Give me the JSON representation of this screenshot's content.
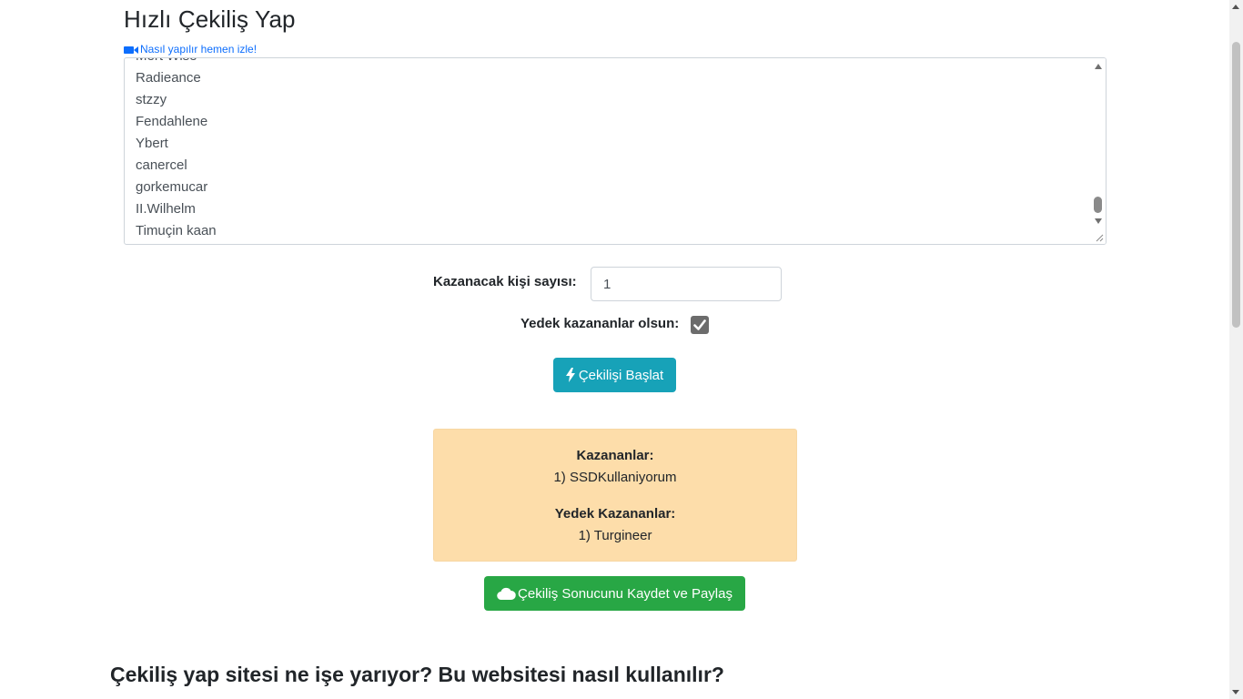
{
  "header": {
    "title": "Hızlı Çekiliş Yap",
    "howto_link": "Nasıl yapılır hemen izle!"
  },
  "participants": {
    "names": [
      "Mert Wise",
      "Radieance",
      "stzzy",
      "Fendahlene",
      "Ybert",
      "canercel",
      "gorkemucar",
      "II.Wilhelm",
      "Timuçin kaan"
    ]
  },
  "form": {
    "winner_count_label": "Kazanacak kişi sayısı:",
    "winner_count_value": "1",
    "backup_label": "Yedek kazananlar olsun:",
    "backup_checked": true,
    "start_button": "Çekilişi Başlat"
  },
  "results": {
    "winners_heading": "Kazananlar:",
    "winners": [
      "1) SSDKullaniyorum"
    ],
    "backup_heading": "Yedek Kazananlar:",
    "backups": [
      "1) Turgineer"
    ]
  },
  "save_button": "Çekiliş Sonucunu Kaydet ve Paylaş",
  "section": {
    "title": "Çekiliş yap sitesi ne işe yarıyor? Bu websitesi nasıl kullanılır?"
  },
  "colors": {
    "start_button": "#17a2b8",
    "save_button": "#28a745",
    "result_bg": "#fdddaa",
    "link": "#0d6efd"
  },
  "icons": {
    "howto": "video-camera-icon",
    "start": "bolt-icon",
    "save": "cloud-icon",
    "checkbox": "check-icon"
  }
}
